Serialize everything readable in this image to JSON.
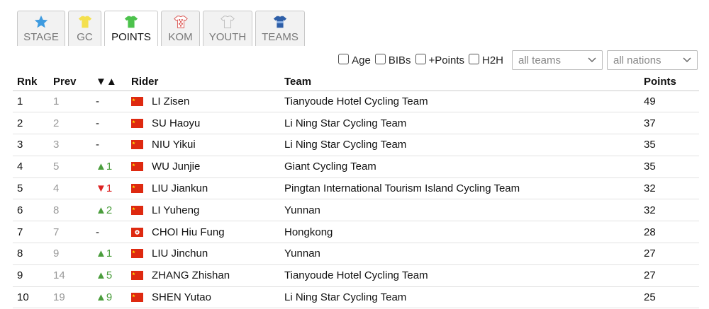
{
  "tabs": [
    {
      "label": "STAGE",
      "icon": "star-icon",
      "color": "#3e9be0",
      "active": false
    },
    {
      "label": "GC",
      "icon": "yellow-jersey-icon",
      "color": "#f4e04d",
      "active": false
    },
    {
      "label": "POINTS",
      "icon": "green-jersey-icon",
      "color": "#4cc24c",
      "active": true
    },
    {
      "label": "KOM",
      "icon": "polka-dot-jersey-icon",
      "color": "#d9534f",
      "active": false
    },
    {
      "label": "YOUTH",
      "icon": "white-jersey-icon",
      "color": "#e8e8e8",
      "active": false
    },
    {
      "label": "TEAMS",
      "icon": "team-jersey-icon",
      "color": "#2e5fa8",
      "active": false
    }
  ],
  "filters": {
    "checkboxes": [
      "Age",
      "BIBs",
      "+Points",
      "H2H"
    ],
    "teams_select": "all teams",
    "nations_select": "all nations"
  },
  "table": {
    "headers": {
      "rnk": "Rnk",
      "prev": "Prev",
      "diff": "▼▲",
      "rider": "Rider",
      "team": "Team",
      "points": "Points"
    },
    "rows": [
      {
        "rnk": "1",
        "prev": "1",
        "diff": "-",
        "trend": "none",
        "flag": "cn",
        "rider": "LI Zisen",
        "team": "Tianyoude Hotel Cycling Team",
        "points": "49"
      },
      {
        "rnk": "2",
        "prev": "2",
        "diff": "-",
        "trend": "none",
        "flag": "cn",
        "rider": "SU Haoyu",
        "team": "Li Ning Star Cycling Team",
        "points": "37"
      },
      {
        "rnk": "3",
        "prev": "3",
        "diff": "-",
        "trend": "none",
        "flag": "cn",
        "rider": "NIU Yikui",
        "team": "Li Ning Star Cycling Team",
        "points": "35"
      },
      {
        "rnk": "4",
        "prev": "5",
        "diff": "▲1",
        "trend": "up",
        "flag": "cn",
        "rider": "WU Junjie",
        "team": "Giant Cycling Team",
        "points": "35"
      },
      {
        "rnk": "5",
        "prev": "4",
        "diff": "▼1",
        "trend": "down",
        "flag": "cn",
        "rider": "LIU Jiankun",
        "team": "Pingtan International Tourism Island Cycling Team",
        "points": "32"
      },
      {
        "rnk": "6",
        "prev": "8",
        "diff": "▲2",
        "trend": "up",
        "flag": "cn",
        "rider": "LI Yuheng",
        "team": "Yunnan",
        "points": "32"
      },
      {
        "rnk": "7",
        "prev": "7",
        "diff": "-",
        "trend": "none",
        "flag": "hk",
        "rider": "CHOI Hiu Fung",
        "team": "Hongkong",
        "points": "28"
      },
      {
        "rnk": "8",
        "prev": "9",
        "diff": "▲1",
        "trend": "up",
        "flag": "cn",
        "rider": "LIU Jinchun",
        "team": "Yunnan",
        "points": "27"
      },
      {
        "rnk": "9",
        "prev": "14",
        "diff": "▲5",
        "trend": "up",
        "flag": "cn",
        "rider": "ZHANG Zhishan",
        "team": "Tianyoude Hotel Cycling Team",
        "points": "27"
      },
      {
        "rnk": "10",
        "prev": "19",
        "diff": "▲9",
        "trend": "up",
        "flag": "cn",
        "rider": "SHEN Yutao",
        "team": "Li Ning Star Cycling Team",
        "points": "25"
      }
    ]
  }
}
